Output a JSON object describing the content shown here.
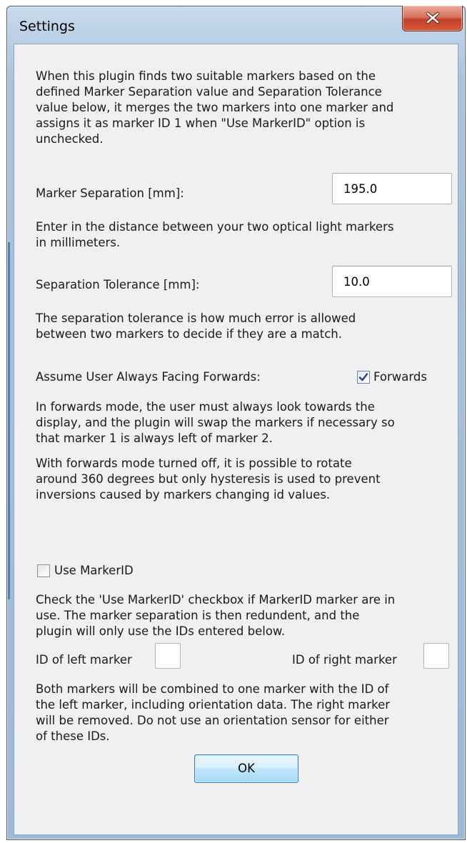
{
  "window": {
    "title": "Settings",
    "close_icon": "close-x-icon"
  },
  "intro_text": "When this plugin finds two suitable markers based on the\ndefined Marker Separation value and Separation Tolerance\nvalue below, it merges the two markers into one marker and\nassigns it as marker ID 1 when \"Use MarkerID\" option is\nunchecked.",
  "marker_separation": {
    "label": "Marker Separation [mm]:",
    "value": "195.0",
    "help": "Enter in the distance between your two optical light markers\nin millimeters."
  },
  "separation_tolerance": {
    "label": "Separation Tolerance [mm]:",
    "value": "10.0",
    "help": "The separation tolerance is how much error is allowed\nbetween two markers to decide if they are a match."
  },
  "forwards": {
    "label": "Assume User Always Facing Forwards:",
    "checkbox_label": "Forwards",
    "checked": true,
    "help_on": "In forwards mode, the user must always look towards the\ndisplay, and the plugin will swap the markers if necessary so\nthat marker 1 is always left of marker 2.",
    "help_off": "With forwards mode turned off, it is possible to rotate\naround 360 degrees but only hysteresis is used to prevent\ninversions caused by markers changing id values."
  },
  "use_marker_id": {
    "checkbox_label": "Use MarkerID",
    "checked": false,
    "help": "Check the 'Use MarkerID' checkbox if MarkerID marker are in\nuse. The marker separation is then redundent, and the\nplugin will only use the IDs entered below."
  },
  "ids": {
    "left_label": "ID of left marker",
    "left_value": "",
    "right_label": "ID of right marker",
    "right_value": ""
  },
  "combine_text": "Both markers will be combined to one marker with the ID of\nthe left marker, including orientation data. The right marker\nwill be removed. Do not use an orientation sensor for either\nof these IDs.",
  "buttons": {
    "ok_label": "OK"
  }
}
